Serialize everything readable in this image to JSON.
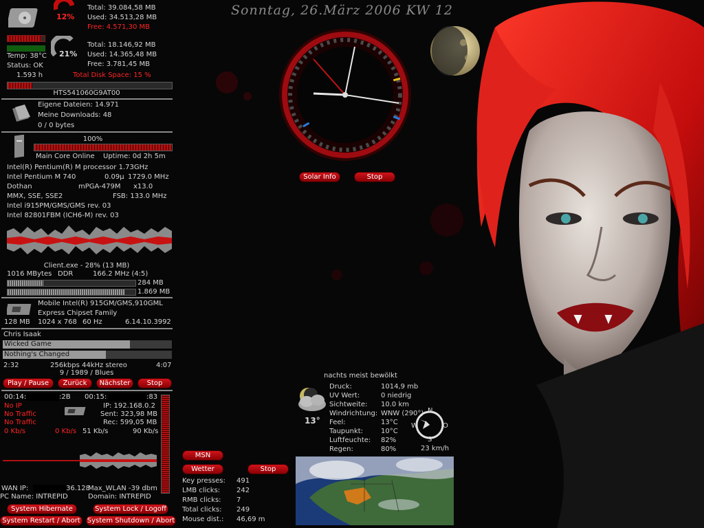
{
  "header": {
    "date": "Sonntag, 26.März 2006 KW 12"
  },
  "disk": {
    "c_percent": "12%",
    "c_total": "Total: 39.084,58 MB",
    "c_used": "Used: 34.513,28 MB",
    "c_free": "Free: 4.571,30 MB",
    "d_percent": "21%",
    "d_total": "Total: 18.146,92 MB",
    "d_used": "Used: 14.365,48 MB",
    "d_free": "Free: 3.781,45 MB",
    "temp": "Temp: 38°C",
    "status": "Status: OK",
    "hours": "1.593 h",
    "total_space": "Total Disk Space: 15 %",
    "model": "HTS541060G9AT00",
    "usage_fraction": 0.15
  },
  "files": {
    "eigene": "Eigene Dateien: 14.971",
    "downloads": "Meine Downloads: 48",
    "bytes": "0 / 0 bytes"
  },
  "cpu": {
    "load": "100%",
    "load_fraction": 1.0,
    "core": "Main Core Online",
    "uptime": "Uptime: 0d 2h 5m",
    "name": "Intel(R) Pentium(R) M processor 1.73GHz",
    "model": "Intel Pentium M 740",
    "process": "0.09µ",
    "clock": "1729.0 MHz",
    "codename": "Dothan",
    "socket": "mPGA-479M",
    "multiplier": "x13.0",
    "features": "MMX, SSE, SSE2",
    "fsb": "FSB: 133.0 MHz",
    "chipset1": "Intel i915PM/GMS/GMS rev. 03",
    "chipset2": "Intel 82801FBM (ICH6-M) rev. 03"
  },
  "memory": {
    "process": "Client.exe - 28% (13 MB)",
    "size": "1016 MBytes",
    "type": "DDR",
    "speed": "166.2 MHz (4:5)",
    "phys": "284 MB",
    "phys_fraction": 0.28,
    "virt": "1.869 MB",
    "virt_fraction": 0.92
  },
  "gpu": {
    "name1": "Mobile Intel(R) 915GM/GMS,910GML",
    "name2": "Express Chipset Family",
    "mem": "128 MB",
    "res": "1024 x 768",
    "hz": "60 Hz",
    "driver": "6.14.10.3992"
  },
  "media": {
    "artist": "Chris Isaak",
    "track1": "Wicked Game",
    "track2": "Nothing's Changed",
    "elapsed": "2:32",
    "bitrate": "256kbps 44kHz stereo",
    "length": "4:07",
    "position": "9 / 1989 / Blues",
    "progress_fraction": 0.61,
    "play_label": "Play / Pause",
    "back_label": "Zurück",
    "next_label": "Nächster",
    "stop_label": "Stop"
  },
  "network": {
    "mac1": "00:14:",
    "mac1_end": ":2B",
    "mac2": "00:15:",
    "mac2_end": ":83",
    "noip": "No IP",
    "ip": "IP: 192.168.0.2",
    "notraffic1": "No Traffic",
    "sent": "Sent: 323,98 MB",
    "notraffic2": "No Traffic",
    "rec": "Rec: 599,05 MB",
    "kbs1": "0 Kb/s",
    "kbs2": "0 Kb/s",
    "kbs3": "51 Kb/s",
    "kbs4": "90 Kb/s",
    "wan": "WAN IP:",
    "wan_end": "36.128",
    "wlan": "Max_WLAN  -39 dbm",
    "pc": "PC Name: INTREPID",
    "domain": "Domain: INTREPID"
  },
  "system": {
    "hibernate": "System Hibernate",
    "lock": "System Lock / Logoff",
    "restart": "System Restart / Abort",
    "shutdown": "System Shutdown / Abort"
  },
  "clock": {
    "solar_label": "Solar Info",
    "stop_label": "Stop"
  },
  "messenger": {
    "msn_label": "MSN",
    "wetter_label": "Wetter",
    "stop_label": "Stop"
  },
  "input": {
    "keys_label": "Key presses:",
    "keys": "491",
    "lmb_label": "LMB clicks:",
    "lmb": "242",
    "rmb_label": "RMB clicks:",
    "rmb": "7",
    "total_label": "Total clicks:",
    "total": "249",
    "dist_label": "Mouse dist.:",
    "dist": "46,69 m"
  },
  "weather": {
    "summary": "nachts meist bewölkt",
    "temp": "13°",
    "rows": [
      {
        "label": "Druck:",
        "value": "1014,9 mb"
      },
      {
        "label": "UV Wert:",
        "value": "0 niedrig"
      },
      {
        "label": "Sichtweite:",
        "value": "10.0 km"
      },
      {
        "label": "Windrichtung:",
        "value": "WNW (290°)"
      },
      {
        "label": "Feel:",
        "value": "13°C"
      },
      {
        "label": "Taupunkt:",
        "value": "10°C"
      },
      {
        "label": "Luftfeuchte:",
        "value": "82%"
      },
      {
        "label": "Regen:",
        "value": "80%"
      }
    ],
    "compass": {
      "n": "N",
      "s": "S",
      "w": "W",
      "o": "O"
    },
    "wind_speed": "23 km/h"
  },
  "colors": {
    "accent": "#d0141a",
    "text": "#d6d6d6",
    "alert": "#ff2424"
  }
}
